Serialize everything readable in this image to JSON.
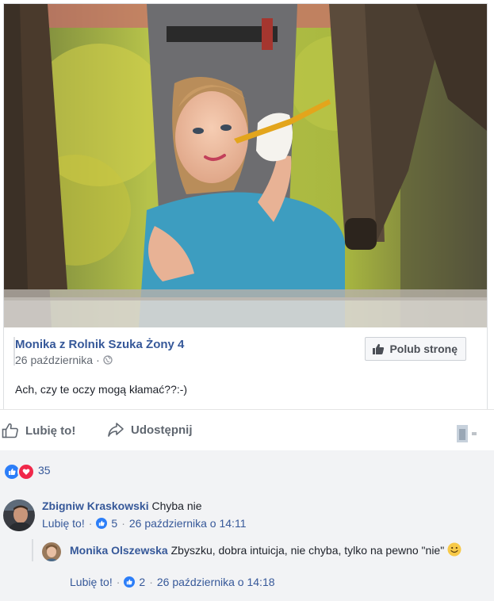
{
  "post": {
    "page_name": "Monika z Rolnik Szuka Żony 4",
    "date": "26 października",
    "separator": "·",
    "text": "Ach, czy te oczy mogą kłamać??:-)",
    "like_page_label": "Polub stronę"
  },
  "actions": {
    "like_label": "Lubię to!",
    "share_label": "Udostępnij"
  },
  "reactions": {
    "count": "35"
  },
  "comments": [
    {
      "author": "Zbigniw Kraskowski",
      "text": "Chyba nie",
      "like_label": "Lubię to!",
      "separator": "·",
      "likes": "5",
      "time": "26 października o 14:11"
    },
    {
      "author": "Monika Olszewska",
      "text": "Zbyszku, dobra intuicja, nie chyba, tylko na pewno \"nie\"",
      "like_label": "Lubię to!",
      "separator": "·",
      "likes": "2",
      "time": "26 października o 14:18"
    }
  ],
  "colors": {
    "link_blue": "#365899",
    "like_blue": "#2c7ef8",
    "love_red": "#f0284a",
    "muted": "#90949c"
  }
}
